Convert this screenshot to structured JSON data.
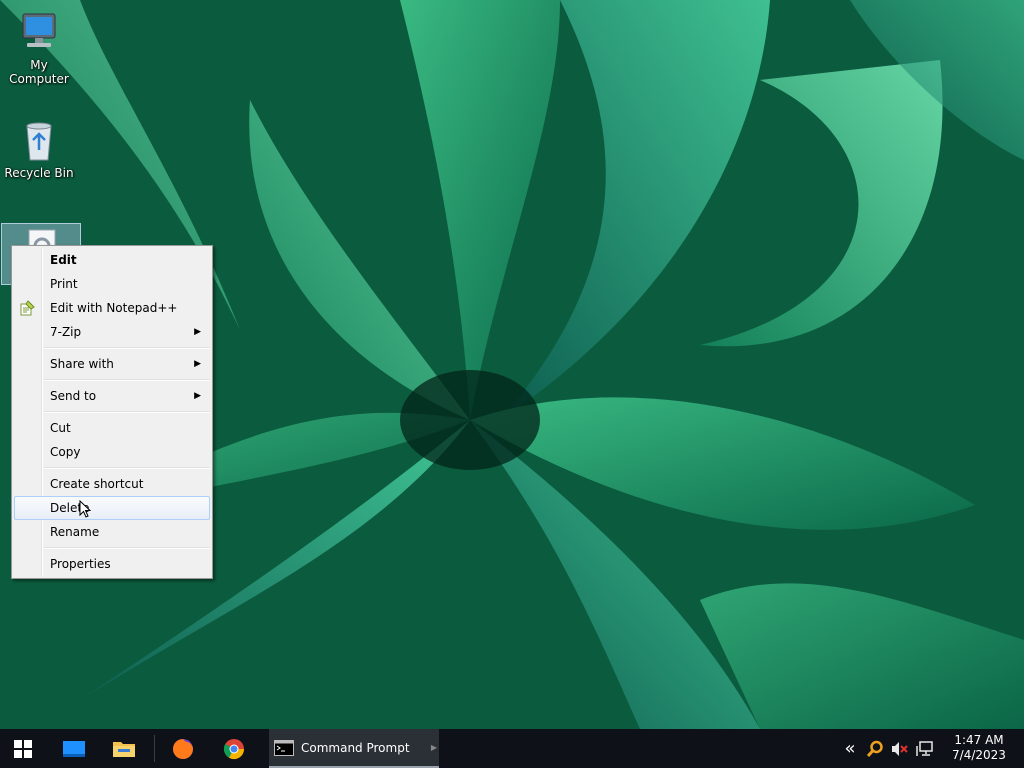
{
  "desktop": {
    "icons": [
      {
        "label": "My Computer",
        "icon": "computer-icon"
      },
      {
        "label": "Recycle Bin",
        "icon": "recycle-bin-icon"
      },
      {
        "label": "",
        "icon": "settings-file-icon"
      }
    ]
  },
  "context_menu": {
    "items": [
      {
        "label": "Edit",
        "bold": true
      },
      {
        "label": "Print"
      },
      {
        "label": "Edit with Notepad++",
        "icon": "notepad-plus-plus-icon"
      },
      {
        "label": "7-Zip",
        "submenu": true
      },
      {
        "label": "Share with",
        "submenu": true
      },
      {
        "label": "Send to",
        "submenu": true
      },
      {
        "label": "Cut"
      },
      {
        "label": "Copy"
      },
      {
        "label": "Create shortcut"
      },
      {
        "label": "Delete",
        "hovered": true
      },
      {
        "label": "Rename"
      },
      {
        "label": "Properties"
      }
    ],
    "arrow_glyph": "▶"
  },
  "taskbar": {
    "start_icon": "windows-start-icon",
    "pinned": [
      "desktop-icon",
      "file-explorer-icon",
      "firefox-icon",
      "chrome-icon"
    ],
    "active_task": {
      "label": "Command Prompt",
      "icon": "command-prompt-icon"
    },
    "tray": {
      "overflow_glyph": "«",
      "icons": [
        "search-icon",
        "volume-muted-icon",
        "network-icon"
      ]
    },
    "clock": {
      "time": "1:47 AM",
      "date": "7/4/2023"
    }
  },
  "colors": {
    "accent": "#aecff7",
    "taskbar": "#0e1218",
    "menu_bg": "#f0f0f0"
  }
}
